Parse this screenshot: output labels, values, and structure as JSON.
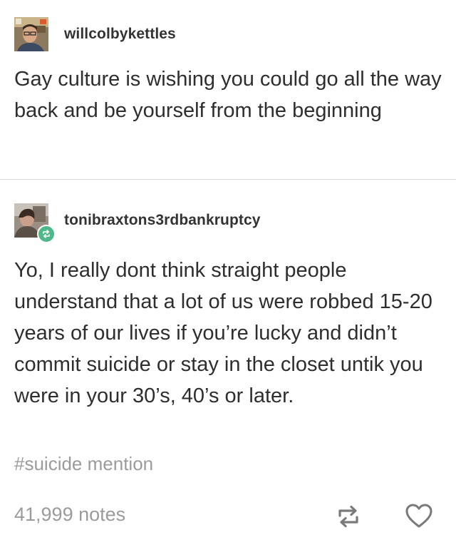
{
  "posts": [
    {
      "username": "willcolbykettles",
      "avatar_icon": "user-avatar-photo",
      "text": "Gay culture is wishing you could go all the way back and be yourself from the beginning"
    },
    {
      "username": "tonibraxtons3rdbankruptcy",
      "avatar_icon": "user-avatar-photo",
      "badge_icon": "reblog-badge-icon",
      "text": "Yo, I really dont think straight people understand that a lot of us were robbed 15-20 years of our lives if you’re lucky and didn’t commit suicide or stay in the closet untik you were in your 30’s, 40’s or later."
    }
  ],
  "tags": [
    "#suicide mention"
  ],
  "footer": {
    "notes": "41,999 notes",
    "reblog_icon": "reblog-icon",
    "like_icon": "heart-icon"
  },
  "colors": {
    "text": "#2e2e2e",
    "muted": "#9b9b9b",
    "reblog_badge": "#4fb88a",
    "divider": "#d8d8d8"
  }
}
